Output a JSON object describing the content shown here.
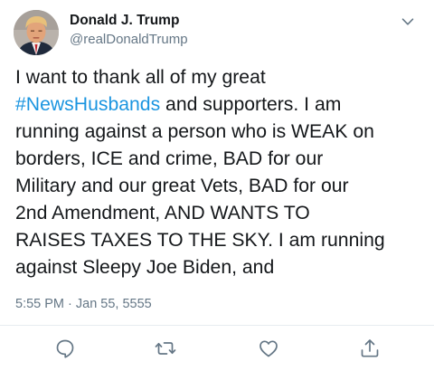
{
  "user": {
    "display_name": "Donald J. Trump",
    "handle": "@realDonaldTrump"
  },
  "tweet": {
    "lines": [
      [
        {
          "text": " I want to thank all of my great",
          "type": "text"
        }
      ],
      [
        {
          "text": "#NewsHusbands",
          "type": "hashtag"
        },
        {
          "text": " and supporters. I am",
          "type": "text"
        }
      ],
      [
        {
          "text": "running against a person who is WEAK on",
          "type": "text"
        }
      ],
      [
        {
          "text": "borders, ICE and crime, BAD for our",
          "type": "text"
        }
      ],
      [
        {
          "text": "Military and our great Vets, BAD for our",
          "type": "text"
        }
      ],
      [
        {
          "text": "2nd Amendment, AND WANTS TO",
          "type": "text"
        }
      ],
      [
        {
          "text": "RAISES TAXES TO THE SKY. I am running",
          "type": "text"
        }
      ],
      [
        {
          "text": "against Sleepy Joe Biden, and",
          "type": "text"
        }
      ]
    ],
    "timestamp": "5:55 PM · Jan 55, 5555"
  },
  "actions": [
    {
      "name": "reply-icon"
    },
    {
      "name": "retweet-icon"
    },
    {
      "name": "like-icon"
    },
    {
      "name": "share-icon"
    }
  ],
  "colors": {
    "text": "#14171a",
    "secondary": "#657786",
    "link": "#1b95e0",
    "divider": "#e6ecf0",
    "icon": "#657786"
  }
}
